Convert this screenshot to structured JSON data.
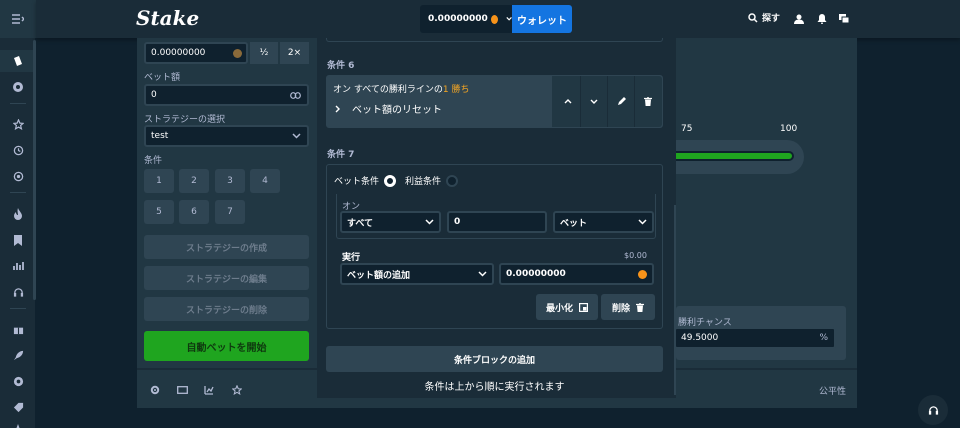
{
  "header": {
    "logo": "Stake",
    "balance": "0.00000000",
    "wallet_label": "ウォレット",
    "search_label": "探す"
  },
  "sidebar": {
    "amount_value": "0.00000000",
    "half_label": "½",
    "double_label": "2×",
    "bet_amount_label": "ベット額",
    "bet_amount_value": "0",
    "strategy_label": "ストラテジーの選択",
    "strategy_value": "test",
    "conditions_label": "条件",
    "condition_numbers": [
      "1",
      "2",
      "3",
      "4",
      "5",
      "6",
      "7"
    ],
    "create_strategy": "ストラテジーの作成",
    "edit_strategy": "ストラテジーの編集",
    "delete_strategy": "ストラテジーの削除",
    "start_autobet": "自動ベットを開始"
  },
  "game": {
    "scale_75": "75",
    "scale_100": "100",
    "progress_fraction": 0.98,
    "win_chance_label": "勝利チャンス",
    "win_chance_value": "49.5000",
    "win_chance_unit": "%",
    "fairness": "公平性"
  },
  "modal": {
    "cond6": {
      "title": "条件 6",
      "summary_prefix": "オン すべての勝利ラインの",
      "summary_highlight": "1 勝ち",
      "action": "ベット額のリセット"
    },
    "cond7": {
      "title": "条件 7",
      "bet_condition": "ベット条件",
      "profit_condition": "利益条件",
      "on_label": "オン",
      "select_all": "すべて",
      "count_value": "0",
      "select_bet": "ベット",
      "execute_label": "実行",
      "execute_amount": "$0.00",
      "select_action": "ベット額の追加",
      "action_value": "0.00000000",
      "minimize": "最小化",
      "delete": "削除"
    },
    "add_block": "条件ブロックの追加",
    "note": "条件は上から順に実行されます"
  },
  "colors": {
    "bg": "#0f212e",
    "panel": "#213743",
    "accent_blue": "#1475e1",
    "green": "#1fa51f",
    "highlight": "#f5a623"
  }
}
